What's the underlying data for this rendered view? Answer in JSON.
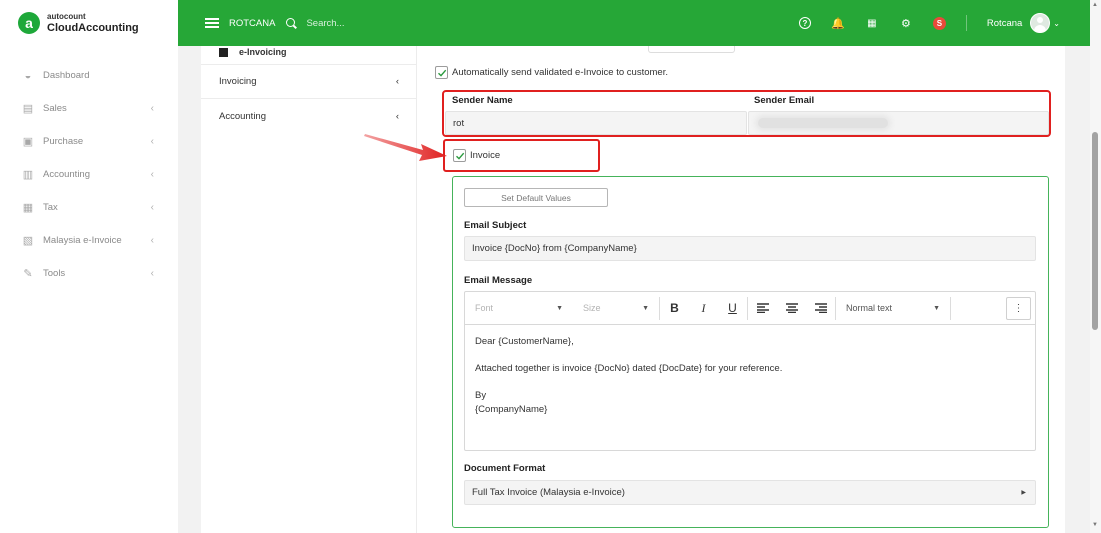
{
  "brand": {
    "logo_letter": "a",
    "top": "autocount",
    "bottom": "CloudAccounting"
  },
  "sidebar": {
    "items": [
      {
        "label": "Dashboard",
        "icon": "dashboard-icon",
        "glyph": "◒",
        "chevron": ""
      },
      {
        "label": "Sales",
        "icon": "sales-icon",
        "glyph": "▤",
        "chevron": "‹"
      },
      {
        "label": "Purchase",
        "icon": "purchase-icon",
        "glyph": "▣",
        "chevron": "‹"
      },
      {
        "label": "Accounting",
        "icon": "accounting-icon",
        "glyph": "▥",
        "chevron": "‹"
      },
      {
        "label": "Tax",
        "icon": "tax-icon",
        "glyph": "▦",
        "chevron": "‹"
      },
      {
        "label": "Malaysia e-Invoice",
        "icon": "einvoice-icon",
        "glyph": "▧",
        "chevron": "‹"
      },
      {
        "label": "Tools",
        "icon": "tools-icon",
        "glyph": "✎",
        "chevron": "‹"
      }
    ]
  },
  "header": {
    "company": "ROTCANA",
    "search_placeholder": "Search...",
    "help_glyph": "?",
    "bell_glyph": "🔔",
    "grid_glyph": "▦",
    "gear_glyph": "⚙",
    "badge_letter": "S",
    "user_name": "Rotcana",
    "user_chevron": "⌄"
  },
  "submenu": {
    "header_label": "e-Invoicing",
    "items": [
      {
        "label": "Invoicing",
        "chevron": "‹"
      },
      {
        "label": "Accounting",
        "chevron": "‹"
      }
    ]
  },
  "form": {
    "auto_send_label": "Automatically send validated e-Invoice to customer.",
    "auto_send_checked": true,
    "sender_name_label": "Sender Name",
    "sender_name_value": "rot",
    "sender_email_label": "Sender Email",
    "invoice_label": "Invoice",
    "invoice_checked": true,
    "set_default_label": "Set Default Values",
    "email_subject_label": "Email Subject",
    "email_subject_value": "Invoice {DocNo} from {CompanyName}",
    "email_message_label": "Email Message",
    "toolbar": {
      "font_placeholder": "Font",
      "size_placeholder": "Size",
      "bold": "B",
      "italic": "I",
      "underline": "U",
      "paragraph_style": "Normal text",
      "more": "⋮"
    },
    "message_lines": {
      "greeting": "Dear {CustomerName},",
      "body": "Attached together is invoice {DocNo} dated {DocDate} for your reference.",
      "closing": "By",
      "signature": "{CompanyName}"
    },
    "document_format_label": "Document Format",
    "document_format_value": "Full Tax Invoice (Malaysia e-Invoice)"
  },
  "colors": {
    "brand_green": "#26a737",
    "panel_border": "#45b35a",
    "highlight_red": "#e0201f",
    "badge_red": "#e84a3a"
  }
}
